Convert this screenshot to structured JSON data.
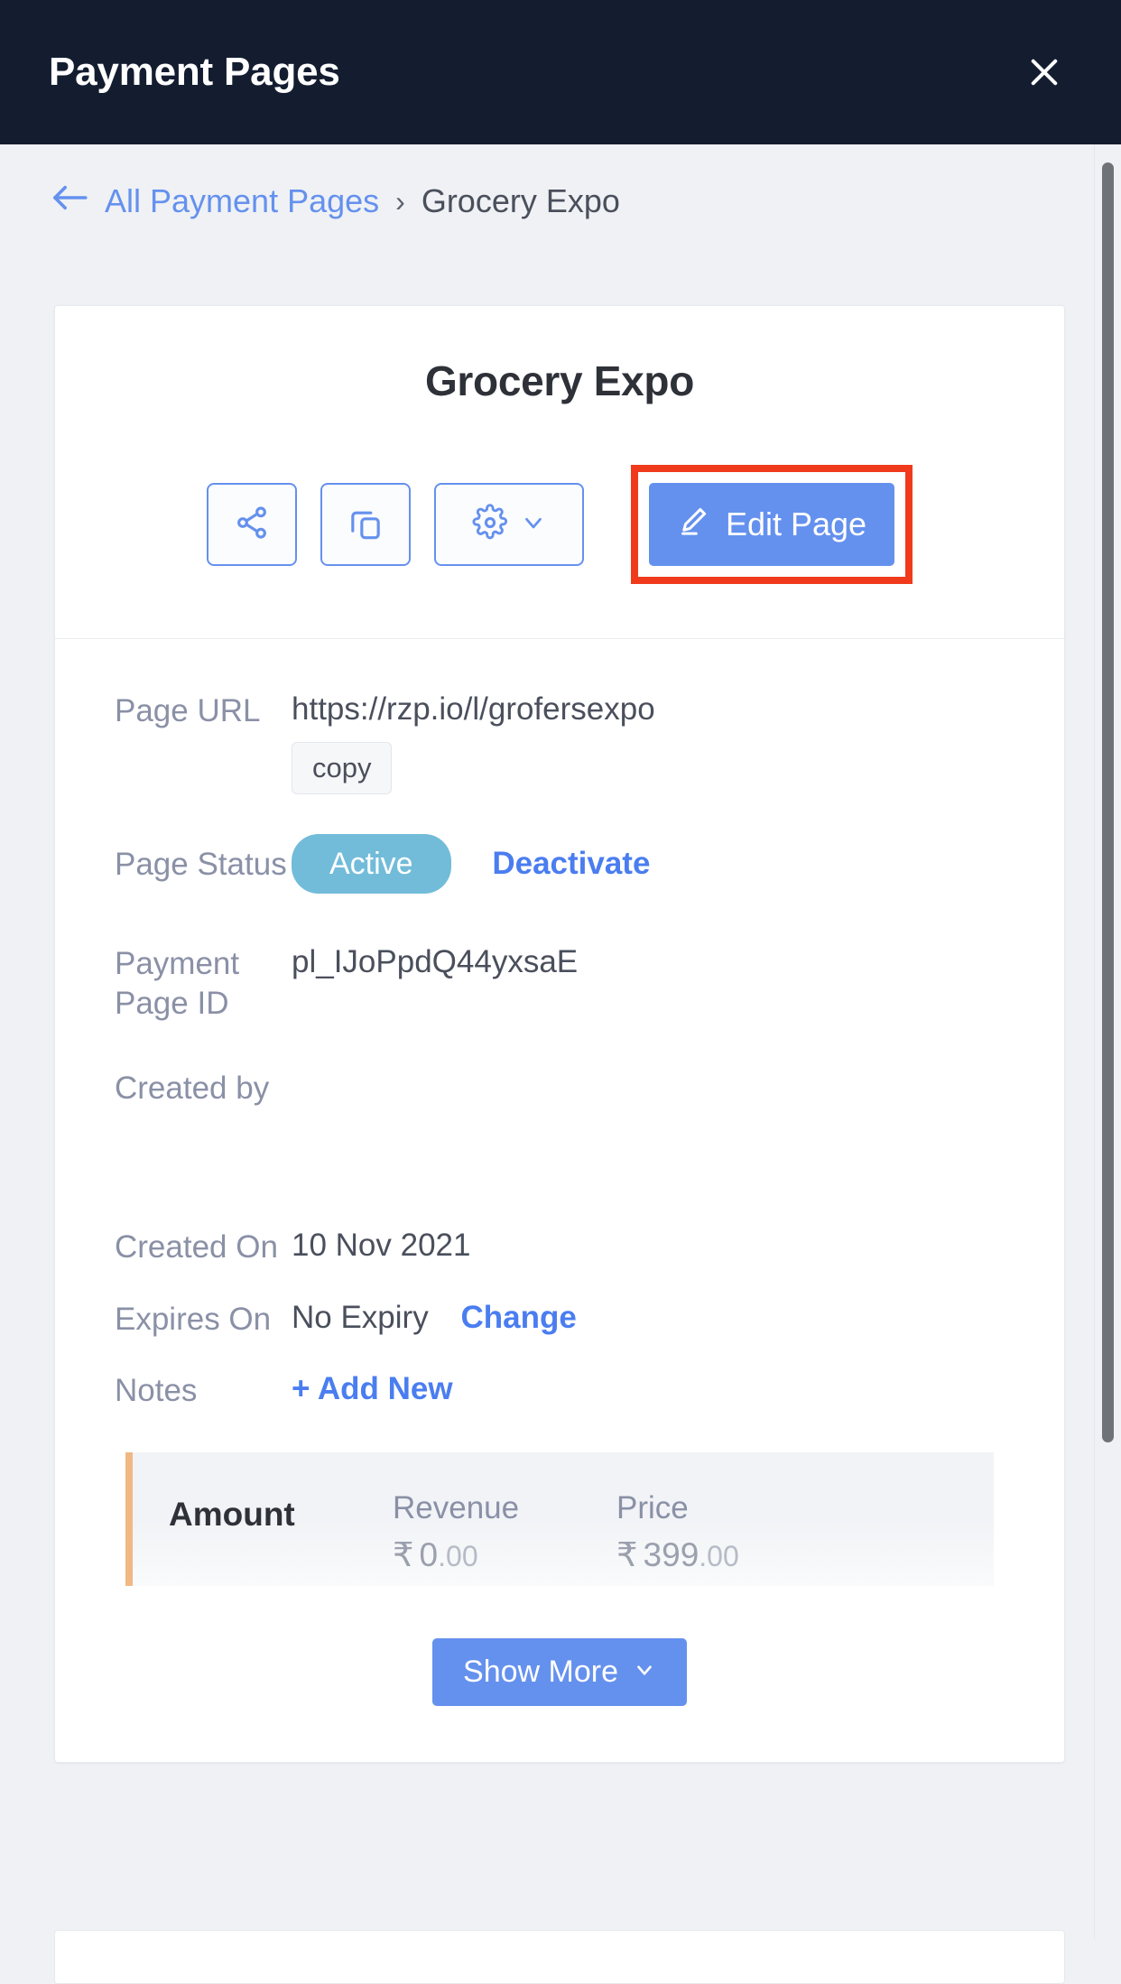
{
  "topbar": {
    "title": "Payment Pages",
    "close_icon": "close-icon"
  },
  "breadcrumb": {
    "back_icon": "arrow-left-icon",
    "parent": "All Payment Pages",
    "separator": "›",
    "current": "Grocery Expo"
  },
  "card": {
    "title": "Grocery Expo",
    "actions": {
      "share_icon": "share-icon",
      "duplicate_icon": "copy-icon",
      "settings_icon": "gear-icon",
      "settings_chevron_icon": "chevron-down-icon",
      "edit_icon": "pencil-icon",
      "edit_label": "Edit Page"
    },
    "details": {
      "page_url": {
        "label": "Page URL",
        "value": "https://rzp.io/l/grofersexpo",
        "copy_label": "copy"
      },
      "page_status": {
        "label": "Page Status",
        "status": "Active",
        "action": "Deactivate"
      },
      "payment_page_id": {
        "label": "Payment Page ID",
        "value": "pl_IJoPpdQ44yxsaE"
      },
      "created_by": {
        "label": "Created by",
        "value": ""
      },
      "created_on": {
        "label": "Created On",
        "value": "10 Nov 2021"
      },
      "expires_on": {
        "label": "Expires On",
        "value": "No Expiry",
        "action": "Change"
      },
      "notes": {
        "label": "Notes",
        "action": "+ Add New"
      }
    },
    "amount": {
      "label": "Amount",
      "revenue": {
        "label": "Revenue",
        "currency": "₹",
        "whole": "0",
        "decimal": ".00"
      },
      "price": {
        "label": "Price",
        "currency": "₹",
        "whole": "399",
        "decimal": ".00"
      }
    },
    "show_more": {
      "label": "Show More",
      "chevron_icon": "chevron-down-icon"
    }
  },
  "colors": {
    "header_bg": "#141d30",
    "accent_blue": "#6591ee",
    "link_blue": "#4a7df0",
    "status_active": "#72bcd9",
    "highlight_red": "#ef3b1c",
    "amount_bar": "#f0b884",
    "page_bg": "#eff1f4"
  }
}
